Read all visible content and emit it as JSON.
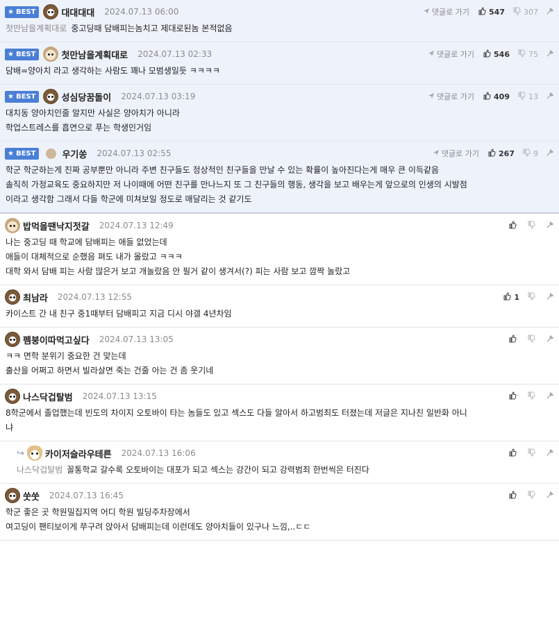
{
  "ui": {
    "best_label": "BEST",
    "reply_label": "댓글로 가기"
  },
  "comments": [
    {
      "best": true,
      "avatar": "bear-avatar",
      "nick": "대대대대",
      "date": "2024.07.13 06:00",
      "up": "547",
      "down": "307",
      "ref": "첫만남을계획대로",
      "lines": [
        "중고딩때 담배피는놈치고 제대로된놈 본적없음"
      ]
    },
    {
      "best": true,
      "avatar": "puppy-avatar",
      "nick": "첫만남을계획대로",
      "date": "2024.07.13 02:33",
      "up": "546",
      "down": "75",
      "ref": "",
      "lines": [
        "담배=양아치 라고 생각하는 사람도 꽤나 모범생일듯 ㅋㅋㅋㅋ"
      ]
    },
    {
      "best": true,
      "avatar": "bear-avatar",
      "nick": "성심당꿈돌이",
      "date": "2024.07.13 03:19",
      "up": "409",
      "down": "13",
      "ref": "",
      "lines": [
        "대치동 양아치인줄 알지만 사실은 양아치가 아니라",
        "학업스트레스를 흡연으로 푸는 학생인거임"
      ]
    },
    {
      "best": true,
      "avatar": "ball-avatar",
      "nick": "우기쏭",
      "date": "2024.07.13 02:55",
      "up": "267",
      "down": "9",
      "ref": "",
      "lines": [
        "학군 학군하는게 진짜 공부뿐만 아니라 주변 친구들도 정상적인 친구들을 만날 수 있는 확률이 높아진다는게 매우 큰 이득같음",
        "솔직히 가정교육도 중요하지만 저 나이때에 어떤 친구를 만나느지 또 그 친구들의 행동, 생각을 보고 배우는게 앞으로의 인생의 시발점",
        "이라고 생각함 그래서 다들 학군에 미쳐보일 정도로 매달리는 것 같기도"
      ]
    },
    {
      "best": false,
      "avatar": "puppy-avatar",
      "nick": "밥먹을땐낙지젓갈",
      "date": "2024.07.13 12:49",
      "up": "",
      "down": "",
      "ref": "",
      "lines": [
        "나는 중고딩 때 학교에 담배피는 애들 없었는데",
        "애들이 대체적으로 순했음 펴도 내가 몰랐고 ㅋㅋㅋ",
        "대학 와서 담배 피는 사람 많은거 보고 개놀랐음 안 필거 같이 생겨서(?) 피는 사람 보고 깜짝 놀랐고"
      ]
    },
    {
      "best": false,
      "avatar": "bear-avatar",
      "nick": "최남라",
      "date": "2024.07.13 12:55",
      "up": "1",
      "down": "",
      "ref": "",
      "lines": [
        "카이스트 간 내 친구 중1때부터 담배피고 지금 디시 야갤 4년차임"
      ]
    },
    {
      "best": false,
      "avatar": "bear-avatar",
      "nick": "펨붕이따먹고싶다",
      "date": "2024.07.13 13:05",
      "up": "",
      "down": "",
      "ref": "",
      "lines": [
        "ㅋㅋ 면학 분위기 중요한 건 맞는데",
        "출산을 어쩌고 하면서 빌라살면 죽는 건줄 아는 건 좀 웃기네"
      ]
    },
    {
      "best": false,
      "avatar": "bear-avatar",
      "nick": "나스닥겁탈범",
      "date": "2024.07.13 13:15",
      "up": "",
      "down": "",
      "ref": "",
      "lines": [
        "8학군에서 졸업했는데 빈도의 차이지 오토바이 타는 놈들도 있고 섹스도 다들 알아서 하고범죄도 터졌는데 저글은 지나친 일반화 아니",
        "냐"
      ]
    },
    {
      "best": false,
      "reply": true,
      "avatar": "fox-avatar",
      "nick": "카이저슬라우테른",
      "date": "2024.07.13 16:06",
      "up": "",
      "down": "",
      "ref": "나스닥겁탈범",
      "lines": [
        "꼴통학교 갈수록 오토바이는 대포가 되고 섹스는 강간이 되고 강력범죄 한번씩은 터진다"
      ]
    },
    {
      "best": false,
      "avatar": "bear-avatar",
      "nick": "쑷쑷",
      "date": "2024.07.13 16:45",
      "up": "",
      "down": "",
      "ref": "",
      "lines": [
        "학군 좋은 곳 학원밀집지역 어디 학원 빌딩주차장에서",
        "여고딩이 팬티보이게 쭈구려 앉아서 담배피는데 이런데도 양아치들이 있구나 느낌,..ㄷㄷ"
      ]
    }
  ]
}
